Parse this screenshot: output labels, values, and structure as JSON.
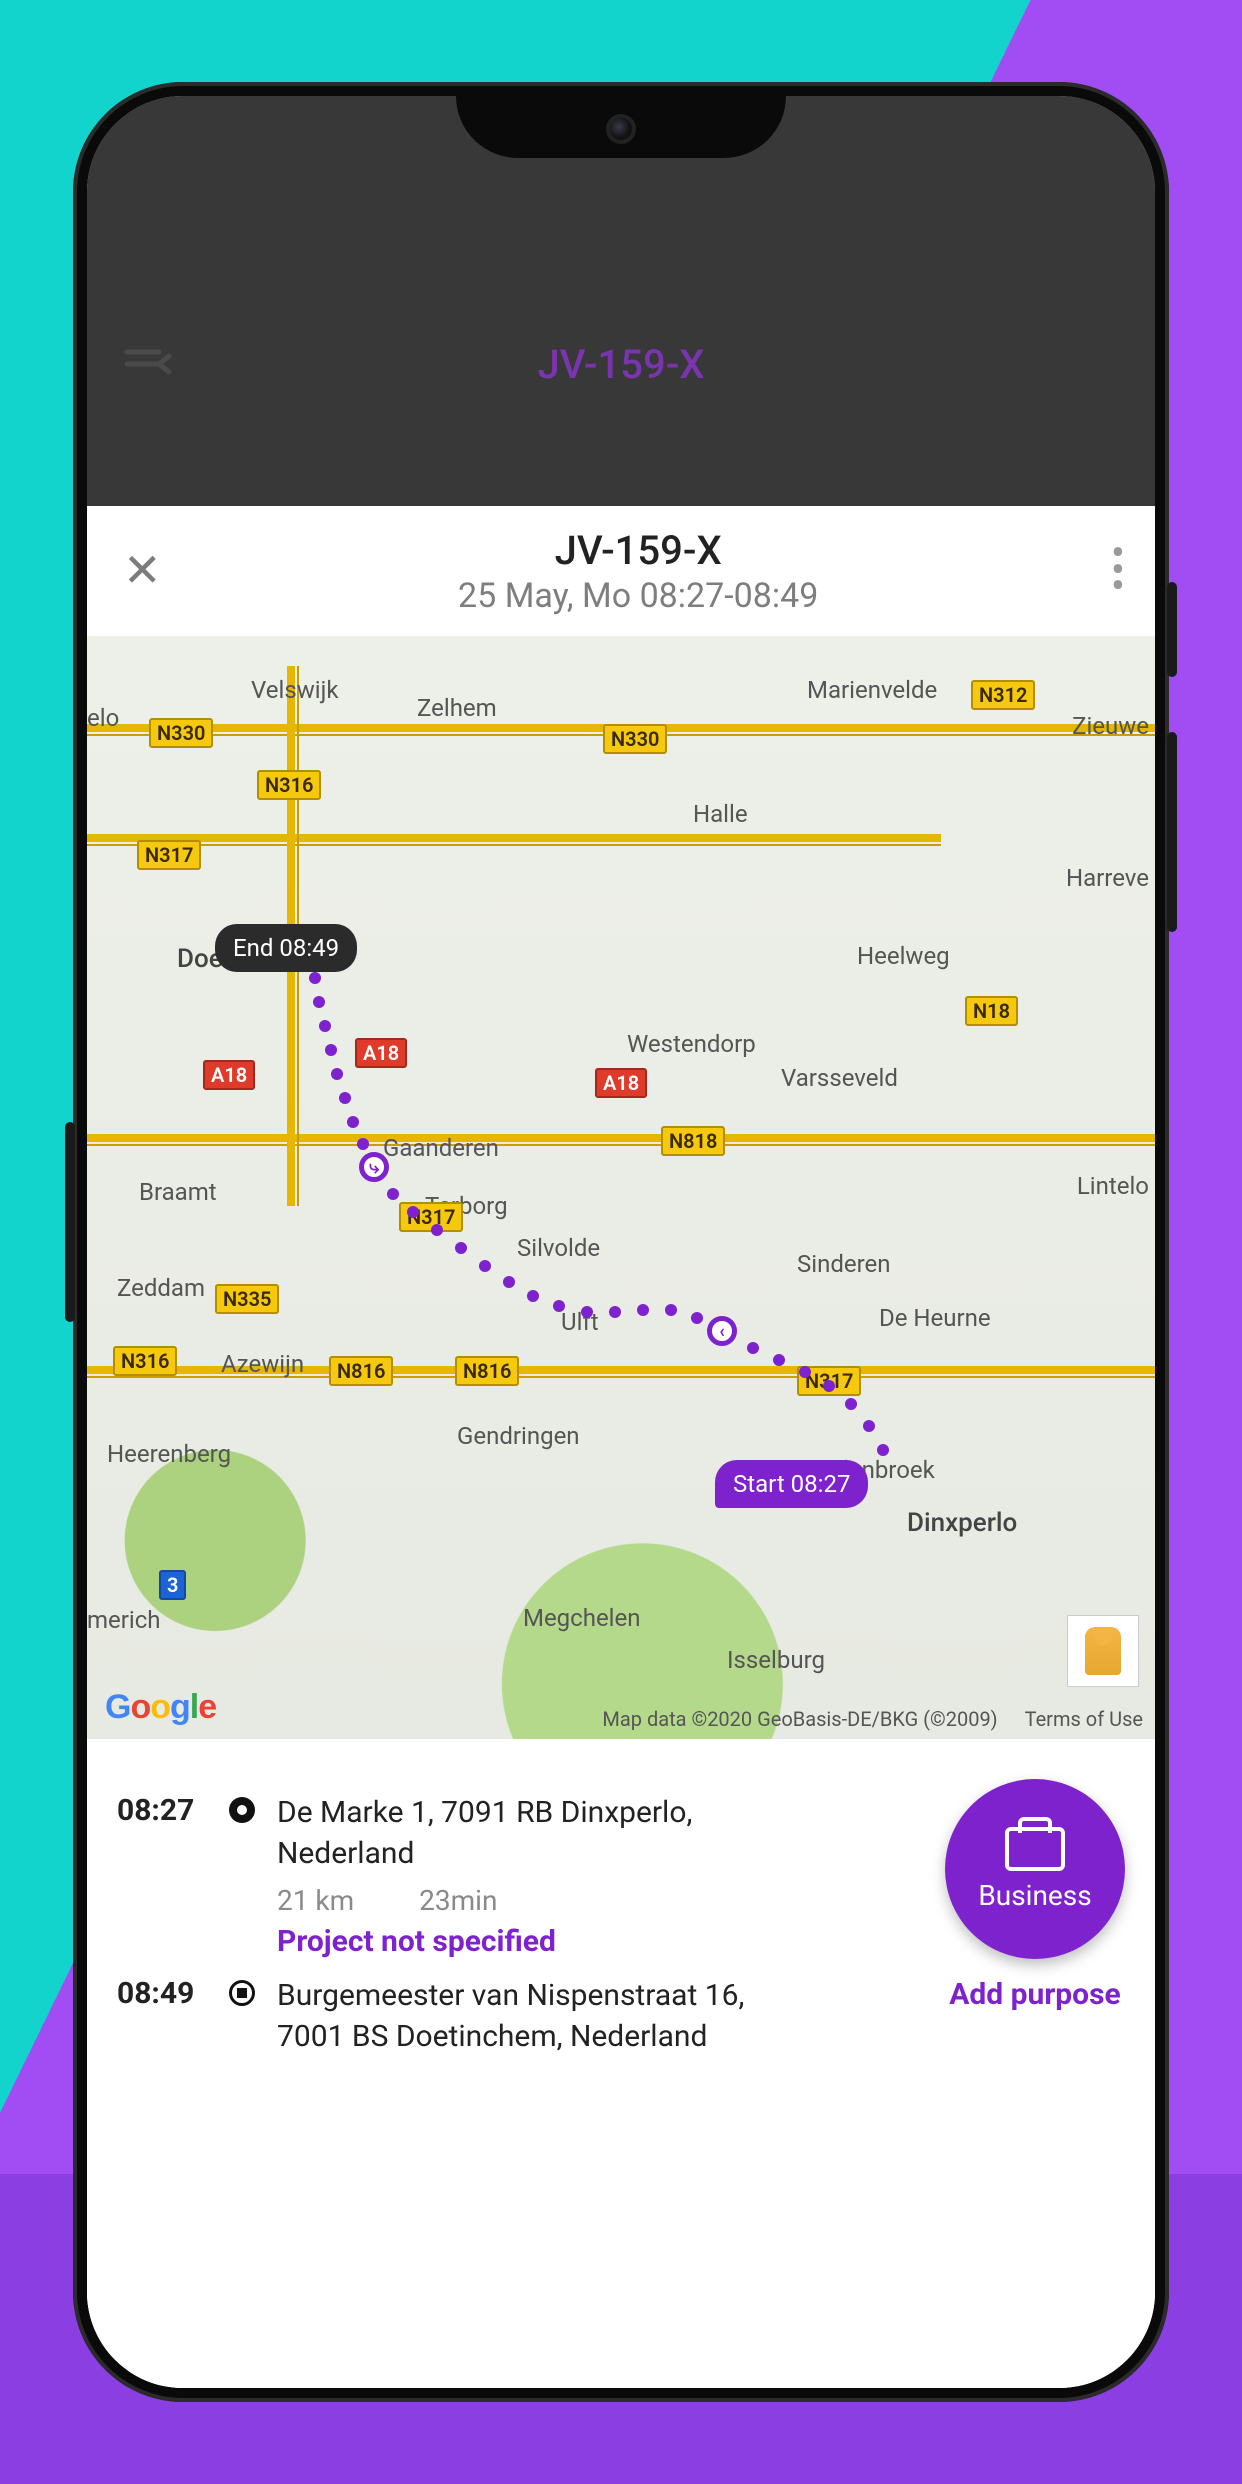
{
  "background_header": {
    "title": "JV-159-X"
  },
  "sheet": {
    "title": "JV-159-X",
    "subtitle": "25 May, Mo 08:27-08:49"
  },
  "map": {
    "start_label": "Start 08:27",
    "end_label": "End 08:49",
    "credits": "Map data ©2020 GeoBasis-DE/BKG (©2009)",
    "terms": "Terms of Use",
    "towns": {
      "velswijk": "Velswijk",
      "zelhem": "Zelhem",
      "marienvelde": "Marienvelde",
      "zieuwe": "Zieuwe",
      "halle": "Halle",
      "harreve": "Harreve",
      "doetinchem": "Doetinchem",
      "heelweg": "Heelweg",
      "westendorp": "Westendorp",
      "varsseveld": "Varsseveld",
      "gaanderen": "Gaanderen",
      "terborg": "Terborg",
      "lintelo": "Lintelo",
      "braamt": "Braamt",
      "silvolde": "Silvolde",
      "sinderen": "Sinderen",
      "zeddam": "Zeddam",
      "ulft": "Ulft",
      "deheurne": "De Heurne",
      "azewijn": "Azewijn",
      "gendringen": "Gendringen",
      "breedenbroek": "Breedenbroek",
      "heerenberg": "Heerenberg",
      "dinxperlo": "Dinxperlo",
      "merich": "merich",
      "megchelen": "Megchelen",
      "isselburg": "Isselburg",
      "elo": "elo"
    },
    "shields": {
      "n330a": "N330",
      "n330b": "N330",
      "n316a": "N316",
      "n317a": "N317",
      "n312": "N312",
      "a18a": "A18",
      "a18b": "A18",
      "a18c": "A18",
      "n818": "N818",
      "n18": "N18",
      "n317b": "N317",
      "n335": "N335",
      "n316b": "N316",
      "n816a": "N816",
      "n816b": "N816",
      "n317c": "N317",
      "three": "3"
    }
  },
  "trip": {
    "start_time": "08:27",
    "start_addr": "De Marke 1, 7091 RB Dinxperlo, Nederland",
    "distance": "21 km",
    "duration": "23min",
    "project": "Project not specified",
    "end_time": "08:49",
    "end_addr": "Burgemeester van Nispenstraat 16, 7001 BS Doetinchem, Nederland"
  },
  "actions": {
    "business": "Business",
    "add_purpose": "Add purpose"
  }
}
